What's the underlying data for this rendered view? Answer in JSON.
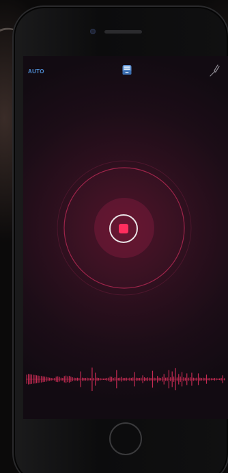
{
  "topbar": {
    "mode_label": "AUTO",
    "archive_icon": "archive-box-icon",
    "tuner_icon": "tuning-fork-icon"
  },
  "recorder": {
    "state": "recording",
    "button_icon": "stop-square-icon",
    "accent_color": "#ff2e5e",
    "ring_color": "#c92a55"
  },
  "waveform": {
    "color": "#c62b53",
    "levels": [
      0.35,
      0.4,
      0.38,
      0.36,
      0.34,
      0.33,
      0.3,
      0.28,
      0.26,
      0.25,
      0.22,
      0.2,
      0.18,
      0.15,
      0.12,
      0.1,
      0.08,
      0.1,
      0.2,
      0.22,
      0.18,
      0.12,
      0.1,
      0.24,
      0.28,
      0.22,
      0.26,
      0.2,
      0.15,
      0.12,
      0.1,
      0.12,
      0.1,
      0.6,
      0.12,
      0.1,
      0.1,
      0.12,
      0.1,
      0.08,
      0.9,
      0.1,
      0.5,
      0.12,
      0.1,
      0.08,
      0.06,
      0.05,
      0.06,
      0.1,
      0.12,
      0.2,
      0.18,
      0.1,
      0.15,
      0.7,
      0.1,
      0.12,
      0.18,
      0.1,
      0.1,
      0.12,
      0.08,
      0.12,
      0.1,
      0.14,
      0.55,
      0.12,
      0.1,
      0.1,
      0.12,
      0.3,
      0.15,
      0.1,
      0.14,
      0.12,
      0.1,
      0.65,
      0.12,
      0.1,
      0.25,
      0.12,
      0.1,
      0.18,
      0.4,
      0.12,
      0.14,
      0.7,
      0.15,
      0.6,
      0.2,
      0.85,
      0.14,
      0.4,
      0.2,
      0.55,
      0.15,
      0.12,
      0.45,
      0.12,
      0.15,
      0.5,
      0.12,
      0.1,
      0.12,
      0.45,
      0.12,
      0.1,
      0.12,
      0.1,
      0.35,
      0.08,
      0.1,
      0.08,
      0.06,
      0.1,
      0.08,
      0.05,
      0.06,
      0.1,
      0.3,
      0.08
    ]
  }
}
